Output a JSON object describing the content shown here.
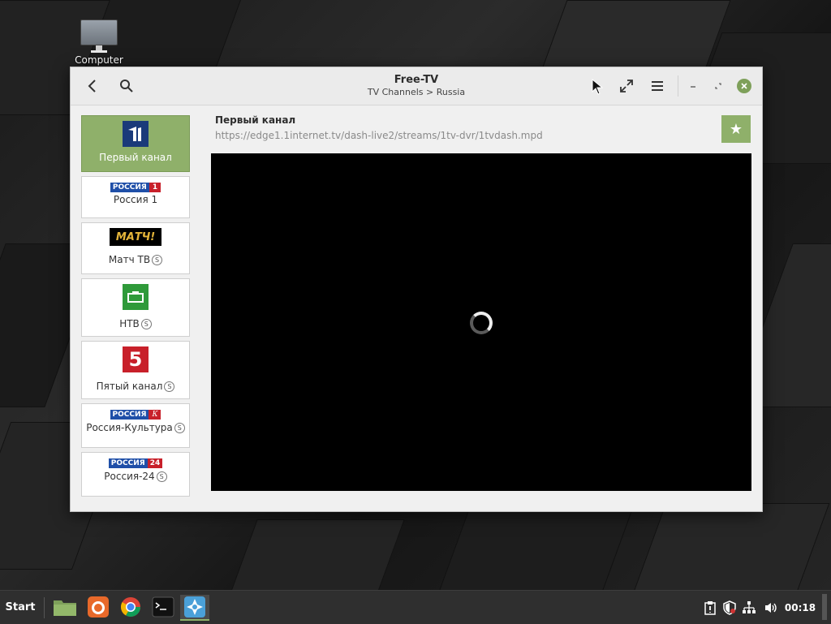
{
  "desktop": {
    "icon_label": "Computer"
  },
  "window": {
    "title": "Free-TV",
    "subtitle": "TV Channels > Russia"
  },
  "channel": {
    "name": "Первый канал",
    "url": "https://edge1.1internet.tv/dash-live2/streams/1tv-dvr/1tvdash.mpd"
  },
  "sidebar": {
    "items": [
      {
        "label": "Первый канал",
        "badge": "",
        "active": true
      },
      {
        "label": "Россия 1",
        "badge": ""
      },
      {
        "label": "Матч ТВ",
        "badge": "S"
      },
      {
        "label": "НТВ",
        "badge": "S"
      },
      {
        "label": "Пятый канал",
        "badge": "S"
      },
      {
        "label": "Россия-Культура",
        "badge": "S"
      },
      {
        "label": "Россия-24",
        "badge": "S"
      }
    ],
    "logos": {
      "rossiya": "РОССИЯ",
      "one": "1",
      "match": "МАТЧ!",
      "five": "5",
      "k": "К",
      "twentyfour": "24"
    }
  },
  "taskbar": {
    "start_label": "Start",
    "clock": "00:18"
  },
  "colors": {
    "accent": "#8fb06a",
    "player_bg": "#000000"
  }
}
